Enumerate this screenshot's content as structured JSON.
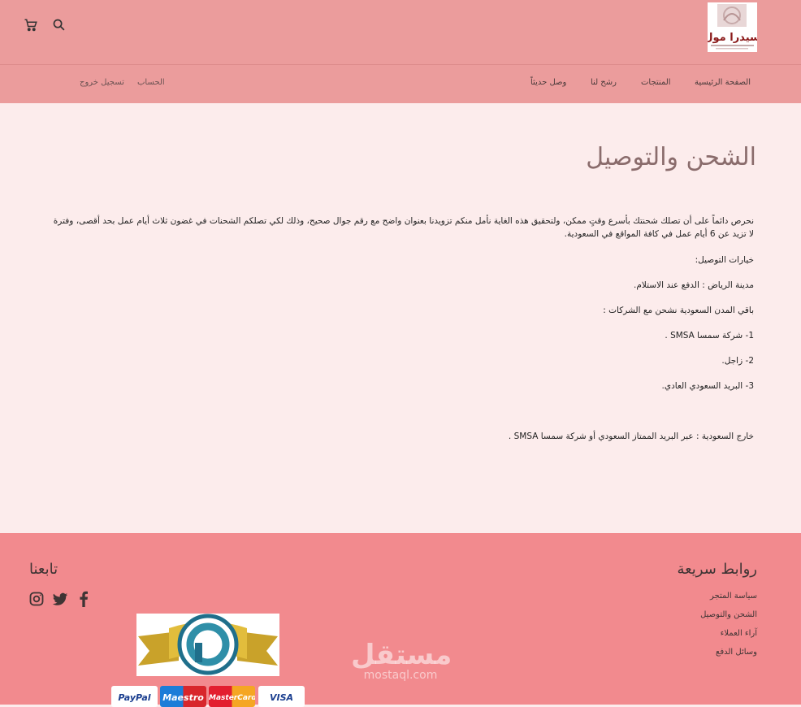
{
  "header": {
    "logo_text": "سيدرا مول",
    "nav": {
      "home": "الصفحة الرئيسية",
      "products": "المنتجات",
      "recommend": "رشح لنا",
      "new_arrivals": "وصل حديثاً"
    },
    "account": "الحساب",
    "logout": "تسجيل خروج"
  },
  "main": {
    "title": "الشحن والتوصيل",
    "paragraphs": [
      "نحرص دائماً على أن تصلك شحنتك بأسرع وقتٍ ممكن، ولتحقيق هذه الغاية نأمل منكم تزويدنا بعنوان واضح مع رقم جوال صحيح، وذلك لكي تصلكم الشحنات في غضون ثلاث أيام عمل بحد أقصى، وفترة لا تزيد عن 6 أيام عمل في كافة المواقع في السعودية.",
      "خيارات التوصيل:",
      "مدينة  الرياض : الدفع عند الاستلام.",
      "باقي المدن السعودية نشحن مع الشركات :",
      "1- شركة سمسا SMSA .",
      "2- زاجل.",
      "3- البريد السعودي العادي.",
      "خارج السعودية : عبر البريد الممتاز السعودي أو شركة سمسا SMSA ."
    ]
  },
  "footer": {
    "quick_links_title": "روابط سريعة",
    "links": [
      "سياسة المتجر",
      "الشحن والتوصيل",
      "آراء العملاء",
      "وسائل الدفع"
    ],
    "follow_title": "تابعنا",
    "payment_cards": [
      "PayPal",
      "Maestro",
      "MasterCard",
      "VISA"
    ],
    "watermark_ar": "مستقل",
    "watermark_en": "mostaql.com"
  },
  "colors": {
    "header_bg": "#eb9c9c",
    "page_bg": "#fcecec",
    "footer_bg": "#f28a8e",
    "title_color": "#8a6c6c"
  },
  "icons": [
    "cart-icon",
    "search-icon",
    "instagram-icon",
    "twitter-icon",
    "facebook-icon"
  ]
}
